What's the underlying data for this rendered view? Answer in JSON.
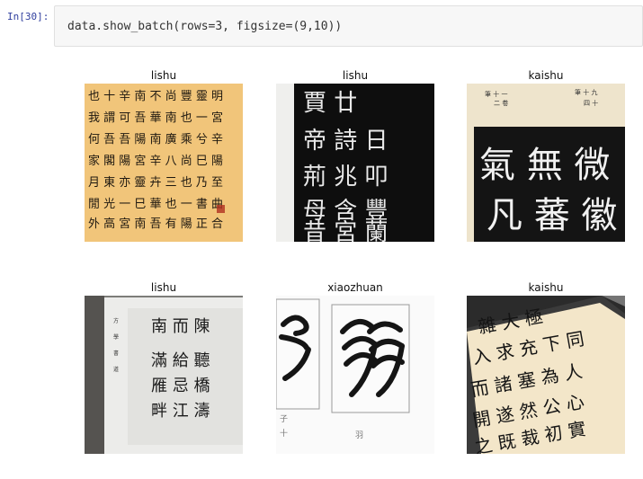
{
  "cell": {
    "prompt": "In[30]:",
    "code": "data.show_batch(rows=3, figsize=(9,10))"
  },
  "batch": [
    {
      "label": "lishu",
      "image": "calligraphy-scroll-tan-background"
    },
    {
      "label": "lishu",
      "image": "stone-rubbing-black-white-characters"
    },
    {
      "label": "kaishu",
      "image": "calligraphy-book-black-panel-characters"
    },
    {
      "label": "lishu",
      "image": "framed-calligraphy-photo"
    },
    {
      "label": "xiaozhuan",
      "image": "seal-script-character-photo"
    },
    {
      "label": "kaishu",
      "image": "tilted-calligraphy-book-page"
    }
  ]
}
